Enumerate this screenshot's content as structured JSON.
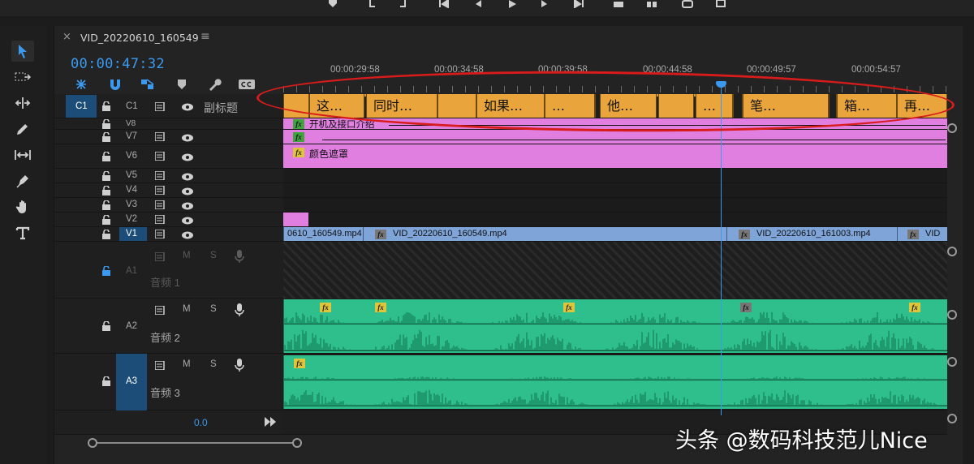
{
  "sequence": {
    "tab_title": "VID_20220610_160549",
    "close_glyph": "×",
    "menu_glyph": "≡",
    "timecode": "00:00:47:32"
  },
  "ruler": {
    "labels": [
      "00:00:29:58",
      "00:00:34:58",
      "00:00:39:58",
      "00:00:44:58",
      "00:00:49:57",
      "00:00:54:57"
    ]
  },
  "tracks": {
    "c1": {
      "target": "C1",
      "name": "C1",
      "label": "副标题"
    },
    "v8": {
      "name": "V8"
    },
    "v7": {
      "name": "V7"
    },
    "v6": {
      "name": "V6"
    },
    "v5": {
      "name": "V5"
    },
    "v4": {
      "name": "V4"
    },
    "v3": {
      "name": "V3"
    },
    "v2": {
      "name": "V2"
    },
    "v1": {
      "name": "V1"
    },
    "a1": {
      "name": "A1",
      "label": "音频 1",
      "m": "M",
      "s": "S"
    },
    "a2": {
      "name": "A2",
      "label": "音频 2",
      "m": "M",
      "s": "S"
    },
    "a3": {
      "name": "A3",
      "label": "音频 3",
      "m": "M",
      "s": "S"
    }
  },
  "captions": [
    {
      "text": "这…"
    },
    {
      "text": "同时…"
    },
    {
      "text": "如果…"
    },
    {
      "text": "…"
    },
    {
      "text": "他…"
    },
    {
      "text": ""
    },
    {
      "text": "…"
    },
    {
      "text": "笔…"
    },
    {
      "text": "箱…"
    },
    {
      "text": "再…"
    }
  ],
  "v8_clip": "开机及接口介绍",
  "v6_clip": "颜色遮罩",
  "v1_clips": [
    {
      "text": "0610_160549.mp4"
    },
    {
      "text": "VID_20220610_160549.mp4"
    },
    {
      "text": "VID_20220610_161003.mp4"
    },
    {
      "text": "VID"
    }
  ],
  "fx_label": "fx",
  "volume": "0.0",
  "watermark": "头条 @数码科技范儿Nice",
  "colors": {
    "accent": "#3b9af0",
    "caption": "#e9a53b",
    "graphics": "#e07fe0",
    "video": "#7ea4d8",
    "audio": "#2fbf8c",
    "annotation": "#d81b1b"
  },
  "icons": {
    "transport": [
      "marker-icon",
      "mark-in-icon",
      "mark-out-icon",
      "go-to-in-icon",
      "step-back-icon",
      "play-icon",
      "step-forward-icon",
      "go-to-out-icon",
      "lift-icon",
      "extract-icon",
      "export-frame-icon",
      "button-editor-icon"
    ],
    "tools": [
      "selection-tool-icon",
      "track-select-icon",
      "ripple-edit-icon",
      "razor-icon",
      "slip-icon",
      "pen-icon",
      "hand-icon",
      "type-icon"
    ],
    "header": [
      "nest-icon",
      "snap-icon",
      "linked-selection-icon",
      "add-marker-icon",
      "settings-wrench-icon",
      "captions-icon"
    ]
  }
}
